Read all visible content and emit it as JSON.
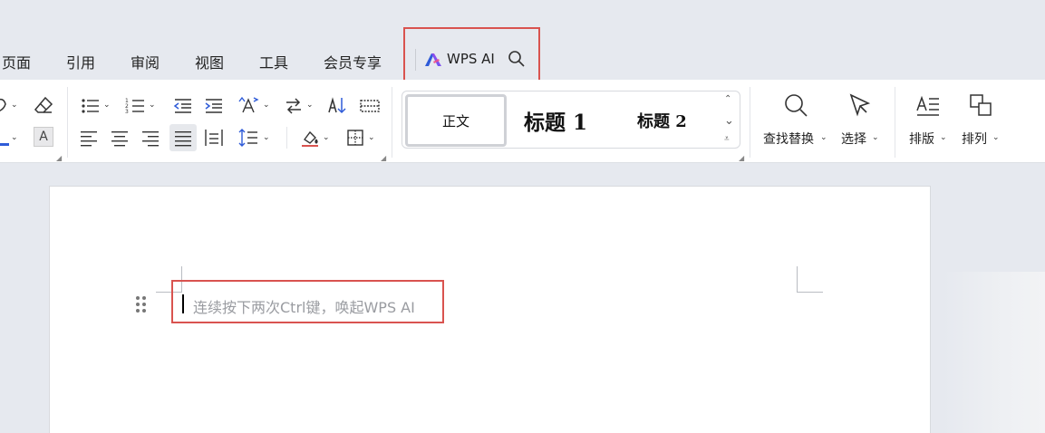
{
  "tabs": [
    {
      "label": "页面"
    },
    {
      "label": "引用"
    },
    {
      "label": "审阅"
    },
    {
      "label": "视图"
    },
    {
      "label": "工具"
    },
    {
      "label": "会员专享"
    }
  ],
  "ai": {
    "label": "WPS AI",
    "highlight_color": "#d9534f"
  },
  "ribbon": {
    "styles": {
      "normal": "正文",
      "heading1": "标题 1",
      "heading2": "标题 2"
    },
    "find_replace": "查找替换",
    "select": "选择",
    "layout": "排版",
    "arrange": "排列"
  },
  "icons": {
    "font_color": "A",
    "highlight": "A",
    "sort": "A↓",
    "gallery_up": "⌃",
    "gallery_down": "⌄",
    "gallery_more": "⩡"
  },
  "document": {
    "hint": "连续按下两次Ctrl键，唤起WPS AI"
  },
  "colors": {
    "accent_blue": "#2e5bd8",
    "highlight_red": "#d9534f"
  }
}
